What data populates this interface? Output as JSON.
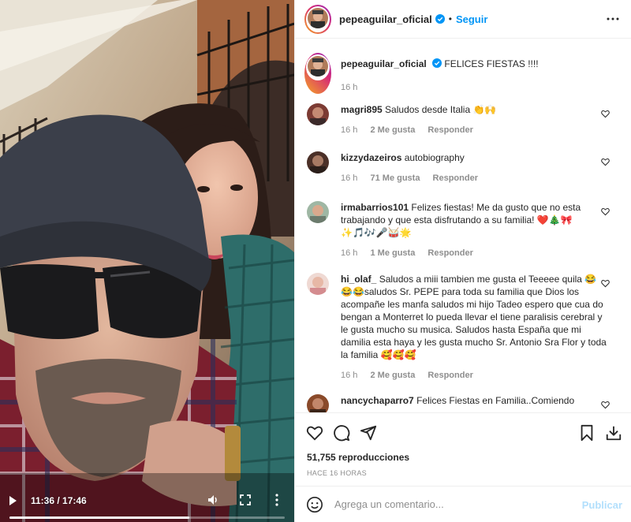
{
  "video": {
    "time": "11:36 / 17:46",
    "progress_fraction": 0.653
  },
  "header": {
    "username": "pepeaguilar_oficial",
    "follow_label": "Seguir",
    "separator": "•"
  },
  "caption": {
    "username": "pepeaguilar_oficial",
    "text": "FELICES FIESTAS !!!!",
    "time": "16 h"
  },
  "comments": [
    {
      "username": "magri895",
      "text": "Saludos desde Italia 👏🙌",
      "time": "16 h",
      "likes": "2 Me gusta",
      "reply": "Responder"
    },
    {
      "username": "kizzydazeiros",
      "text": "autobiography",
      "time": "16 h",
      "likes": "71 Me gusta",
      "reply": "Responder"
    },
    {
      "username": "irmabarrios101",
      "text": "Felizes fiestas! Me da gusto que no esta trabajando y que esta disfrutando a su familia! ❤️🎄🎀✨🎵🎶🎤🥁🌟",
      "time": "16 h",
      "likes": "1 Me gusta",
      "reply": "Responder"
    },
    {
      "username": "hi_olaf_",
      "text": "Saludos a miii tambien me gusta el Teeeee quila 😂😂😂saludos Sr. PEPE para toda su familia que Dios los acompañe les manfa saludos mi hijo Tadeo espero que cua do bengan a Monterret lo pueda llevar el tiene paralisis cerebral y le gusta mucho su musica. Saludos hasta España que mi damilia esta haya y les gusta mucho Sr. Antonio Sra Flor y toda la familia 🥰🥰🥰",
      "time": "16 h",
      "likes": "2 Me gusta",
      "reply": "Responder"
    },
    {
      "username": "nancychaparro7",
      "text": "Felices Fiestas en Familia..Comiendo",
      "time": "",
      "likes": "",
      "reply": ""
    }
  ],
  "stats": {
    "views": "51,755 reproducciones",
    "ago": "HACE 16 HORAS"
  },
  "add_comment": {
    "placeholder": "Agrega un comentario...",
    "post_label": "Publicar"
  },
  "colors": {
    "link": "#0095f6",
    "post_disabled": "#b2dffc",
    "like_red": "#ed4956"
  }
}
